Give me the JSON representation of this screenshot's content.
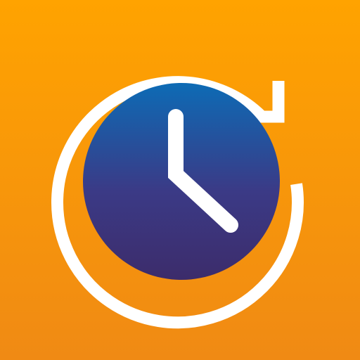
{
  "icon": {
    "name": "clock-history-icon",
    "arrow_icon": "refresh-arrow-icon",
    "clock_hands_icon": "clock-hands-icon"
  },
  "colors": {
    "background_top": "#ffa300",
    "background_bottom": "#f08a14",
    "clock_face_top": "#0d6bb5",
    "clock_face_bottom": "#3c2c6b",
    "ring_and_hands": "#ffffff"
  }
}
